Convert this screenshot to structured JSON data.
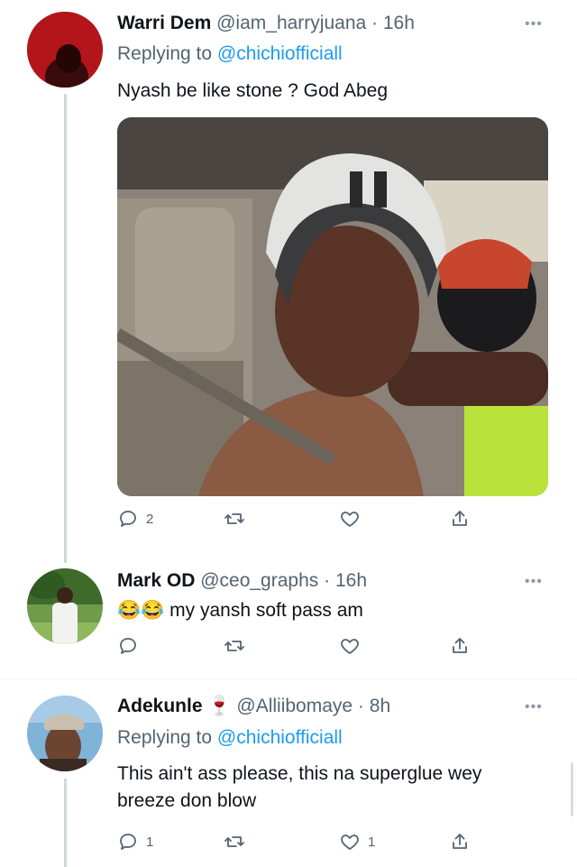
{
  "tweets": [
    {
      "name": "Warri Dem",
      "handle": "@iam_harryjuana",
      "time": "16h",
      "replying_prefix": "Replying to ",
      "replying_to": "@chichiofficiall",
      "text": "Nyash be like stone ? God Abeg",
      "reply_count": "2",
      "retweet_count": "",
      "like_count": ""
    },
    {
      "name": "Mark OD",
      "handle": "@ceo_graphs",
      "time": "16h",
      "emoji": "😂😂",
      "text": "my yansh soft pass am",
      "reply_count": "",
      "retweet_count": "",
      "like_count": ""
    },
    {
      "name": "Adekunle",
      "name_emoji": "🍷",
      "handle": "@Alliibomaye",
      "time": "8h",
      "replying_prefix": "Replying to ",
      "replying_to": "@chichiofficiall",
      "text_line1": "This ain't ass please, this na superglue wey",
      "text_line2": "breeze don blow",
      "reply_count": "1",
      "retweet_count": "",
      "like_count": "1"
    }
  ],
  "separator": "·",
  "more_icon": "more-icon",
  "colors": {
    "link": "#1d9bf0",
    "secondary": "#536471",
    "line": "#cfd9de"
  }
}
